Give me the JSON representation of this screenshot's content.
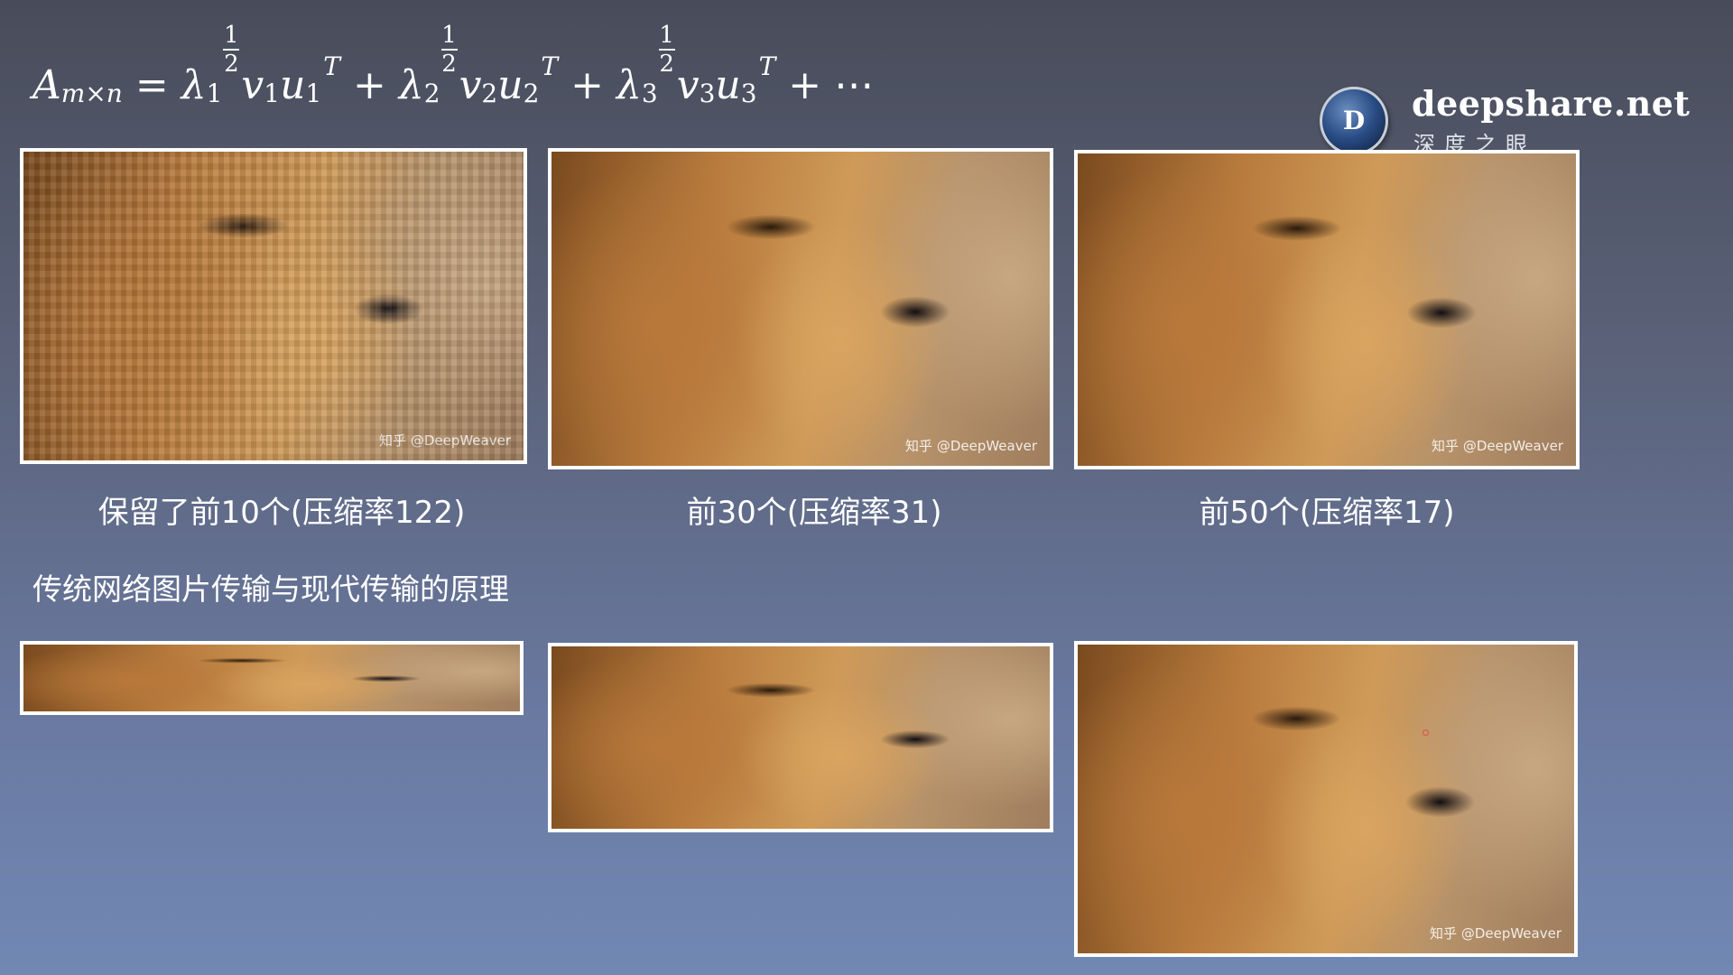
{
  "formula": {
    "lhs_symbol": "A",
    "lhs_subscript": "m×n",
    "equals": "=",
    "terms": [
      {
        "lambda": "λ",
        "lambda_sub": "1",
        "exp_num": "1",
        "exp_den": "2",
        "v": "v",
        "v_sub": "1",
        "u": "u",
        "u_sub": "1",
        "sup": "T"
      },
      {
        "lambda": "λ",
        "lambda_sub": "2",
        "exp_num": "1",
        "exp_den": "2",
        "v": "v",
        "v_sub": "2",
        "u": "u",
        "u_sub": "2",
        "sup": "T"
      },
      {
        "lambda": "λ",
        "lambda_sub": "3",
        "exp_num": "1",
        "exp_den": "2",
        "v": "v",
        "v_sub": "3",
        "u": "u",
        "u_sub": "3",
        "sup": "T"
      }
    ],
    "plus": "+",
    "ellipsis": "+ ⋯"
  },
  "logo": {
    "initial": "D",
    "name": "deepshare.net",
    "subtitle": "深度之眼"
  },
  "watermark": "知乎 @DeepWeaver",
  "captions": {
    "first": "保留了前10个(压缩率122)",
    "second": "前30个(压缩率31)",
    "third": "前50个(压缩率17)"
  },
  "section_title": "传统网络图片传输与现代传输的原理"
}
